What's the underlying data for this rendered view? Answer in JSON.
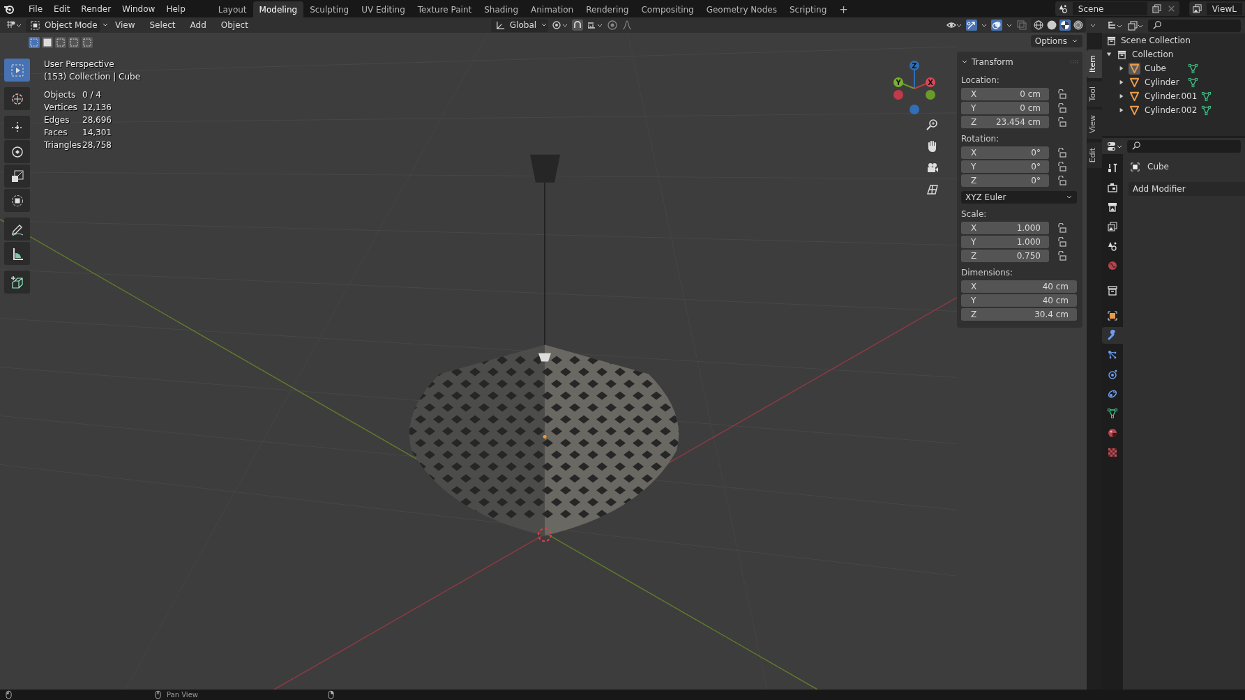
{
  "top_menu": [
    "File",
    "Edit",
    "Render",
    "Window",
    "Help"
  ],
  "workspace_tabs": [
    {
      "label": "Layout",
      "selected": false
    },
    {
      "label": "Modeling",
      "selected": true
    },
    {
      "label": "Sculpting",
      "selected": false
    },
    {
      "label": "UV Editing",
      "selected": false
    },
    {
      "label": "Texture Paint",
      "selected": false
    },
    {
      "label": "Shading",
      "selected": false
    },
    {
      "label": "Animation",
      "selected": false
    },
    {
      "label": "Rendering",
      "selected": false
    },
    {
      "label": "Compositing",
      "selected": false
    },
    {
      "label": "Geometry Nodes",
      "selected": false
    },
    {
      "label": "Scripting",
      "selected": false
    }
  ],
  "add_workspace": "+",
  "scene": {
    "name": "Scene"
  },
  "view_layer": {
    "name": "ViewL"
  },
  "viewport_header": {
    "mode": "Object Mode",
    "menus": [
      "View",
      "Select",
      "Add",
      "Object"
    ],
    "orientation": "Global"
  },
  "select_modes": [
    {
      "selected": true
    },
    {
      "selected": false
    },
    {
      "selected": false
    },
    {
      "selected": false
    },
    {
      "selected": false
    }
  ],
  "tools": [
    {
      "kind": "select",
      "selected": true
    },
    {
      "kind": "cursor",
      "selected": false
    },
    {
      "kind": "move",
      "selected": false
    },
    {
      "kind": "rotate",
      "selected": false
    },
    {
      "kind": "scale",
      "selected": false
    },
    {
      "kind": "transform",
      "selected": false
    },
    {
      "kind": "annotate",
      "selected": false
    },
    {
      "kind": "measure",
      "selected": false
    },
    {
      "kind": "add-cube",
      "selected": false
    }
  ],
  "viewport_info": {
    "view_name": "User Perspective",
    "context": "(153) Collection | Cube",
    "stats": [
      {
        "label": "Objects",
        "value": "0 / 4"
      },
      {
        "label": "Vertices",
        "value": "12,136"
      },
      {
        "label": "Edges",
        "value": "28,696"
      },
      {
        "label": "Faces",
        "value": "14,301"
      },
      {
        "label": "Triangles",
        "value": "28,758"
      }
    ]
  },
  "gizmo": {
    "x": "X",
    "y": "Y",
    "z": "Z"
  },
  "options_button": "Options",
  "sidebar_tabs": [
    {
      "label": "Item",
      "selected": true
    },
    {
      "label": "Tool",
      "selected": false
    },
    {
      "label": "View",
      "selected": false
    },
    {
      "label": "Edit",
      "selected": false
    }
  ],
  "transform": {
    "title": "Transform",
    "expanded": true,
    "location": {
      "label": "Location:",
      "rows": [
        {
          "axis": "X",
          "value": "0 cm",
          "locked": false
        },
        {
          "axis": "Y",
          "value": "0 cm",
          "locked": false
        },
        {
          "axis": "Z",
          "value": "23.454 cm",
          "locked": false
        }
      ]
    },
    "rotation": {
      "label": "Rotation:",
      "rows": [
        {
          "axis": "X",
          "value": "0°",
          "locked": false
        },
        {
          "axis": "Y",
          "value": "0°",
          "locked": false
        },
        {
          "axis": "Z",
          "value": "0°",
          "locked": false
        }
      ]
    },
    "rotation_mode": "XYZ Euler",
    "scale": {
      "label": "Scale:",
      "rows": [
        {
          "axis": "X",
          "value": "1.000",
          "locked": false
        },
        {
          "axis": "Y",
          "value": "1.000",
          "locked": false
        },
        {
          "axis": "Z",
          "value": "0.750",
          "locked": false
        }
      ]
    },
    "dimensions": {
      "label": "Dimensions:",
      "rows": [
        {
          "axis": "X",
          "value": "40 cm"
        },
        {
          "axis": "Y",
          "value": "40 cm"
        },
        {
          "axis": "Z",
          "value": "30.4 cm"
        }
      ]
    }
  },
  "outliner": {
    "root": "Scene Collection",
    "children": [
      {
        "name": "Collection",
        "kind": "collection",
        "expanded": true,
        "selected": false,
        "children": [
          {
            "name": "Cube",
            "kind": "mesh",
            "expanded": false,
            "selected": true
          },
          {
            "name": "Cylinder",
            "kind": "mesh",
            "expanded": false,
            "selected": false
          },
          {
            "name": "Cylinder.001",
            "kind": "mesh",
            "expanded": false,
            "selected": false
          },
          {
            "name": "Cylinder.002",
            "kind": "mesh",
            "expanded": false,
            "selected": false
          }
        ]
      }
    ]
  },
  "properties": {
    "object_name": "Cube",
    "add_modifier": "Add Modifier",
    "tabs": [
      {
        "kind": "tool",
        "selected": false
      },
      {
        "kind": "render",
        "selected": false
      },
      {
        "kind": "output",
        "selected": false
      },
      {
        "kind": "view-layer",
        "selected": false
      },
      {
        "kind": "scene",
        "selected": false
      },
      {
        "kind": "world",
        "selected": false
      },
      {
        "kind": "collection",
        "selected": false
      },
      {
        "kind": "object",
        "selected": false
      },
      {
        "kind": "modifier",
        "selected": true
      },
      {
        "kind": "particles",
        "selected": false
      },
      {
        "kind": "physics",
        "selected": false
      },
      {
        "kind": "constraints",
        "selected": false
      },
      {
        "kind": "data",
        "selected": false
      },
      {
        "kind": "material",
        "selected": false
      },
      {
        "kind": "texture",
        "selected": false
      }
    ]
  },
  "status_bar": {
    "hints": [
      "Pan View"
    ]
  }
}
